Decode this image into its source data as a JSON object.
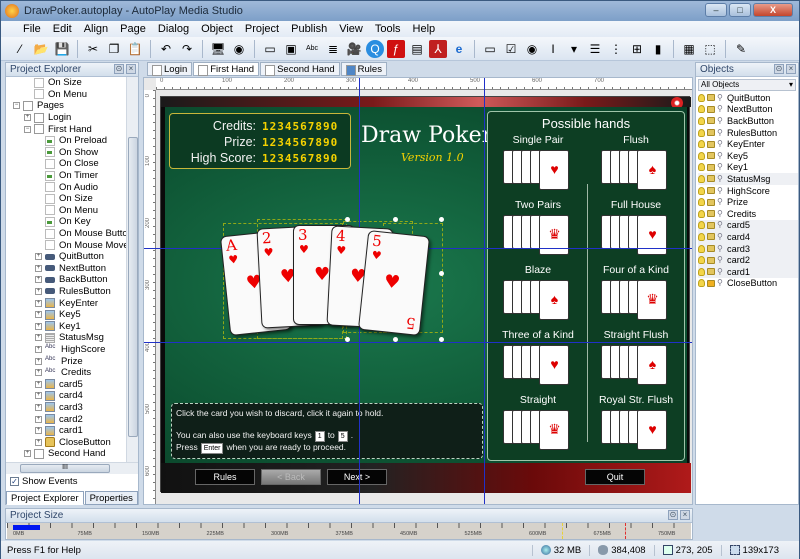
{
  "window": {
    "title": "DrawPoker.autoplay - AutoPlay Media Studio",
    "minimize": "–",
    "maximize": "□",
    "close": "X"
  },
  "menu": [
    "File",
    "Edit",
    "Align",
    "Page",
    "Dialog",
    "Object",
    "Project",
    "Publish",
    "View",
    "Tools",
    "Help"
  ],
  "toolbar_icons": [
    "magic-wand-icon",
    "open-folder-icon",
    "save-icon",
    "cut-icon",
    "copy-icon",
    "paste-icon",
    "undo-icon",
    "redo-icon",
    "preview-icon",
    "publish-icon",
    "button-object-icon",
    "image-object-icon",
    "label-object-icon",
    "paragraph-object-icon",
    "video-object-icon",
    "quicktime-object-icon",
    "flash-object-icon",
    "slideshow-object-icon",
    "pdf-object-icon",
    "web-object-icon",
    "input-object-icon",
    "checkbox-object-icon",
    "radio-object-icon",
    "textbox-object-icon",
    "combobox-object-icon",
    "listbox-object-icon",
    "tree-object-icon",
    "grid-object-icon",
    "progress-object-icon",
    "xbutton-object-icon",
    "hotspot-object-icon",
    "pencil-icon"
  ],
  "project_explorer": {
    "title": "Project Explorer",
    "items": [
      {
        "label": "On Size",
        "type": "evt",
        "indent": 2
      },
      {
        "label": "On Menu",
        "type": "evt",
        "indent": 2
      },
      {
        "label": "Pages",
        "type": "page",
        "indent": 1,
        "expander": "−"
      },
      {
        "label": "Login",
        "type": "page",
        "indent": 2,
        "expander": "+"
      },
      {
        "label": "First Hand",
        "type": "page",
        "indent": 2,
        "expander": "−"
      },
      {
        "label": "On Preload",
        "type": "evt act",
        "indent": 3
      },
      {
        "label": "On Show",
        "type": "evt act",
        "indent": 3
      },
      {
        "label": "On Close",
        "type": "evt",
        "indent": 3
      },
      {
        "label": "On Timer",
        "type": "evt act",
        "indent": 3
      },
      {
        "label": "On Audio",
        "type": "evt",
        "indent": 3
      },
      {
        "label": "On Size",
        "type": "evt",
        "indent": 3
      },
      {
        "label": "On Menu",
        "type": "evt",
        "indent": 3
      },
      {
        "label": "On Key",
        "type": "evt act",
        "indent": 3
      },
      {
        "label": "On Mouse Button",
        "type": "evt",
        "indent": 3
      },
      {
        "label": "On Mouse Move",
        "type": "evt",
        "indent": 3
      },
      {
        "label": "QuitButton",
        "type": "btn",
        "indent": 3,
        "expander": "+"
      },
      {
        "label": "NextButton",
        "type": "btn",
        "indent": 3,
        "expander": "+"
      },
      {
        "label": "BackButton",
        "type": "btn",
        "indent": 3,
        "expander": "+"
      },
      {
        "label": "RulesButton",
        "type": "btn",
        "indent": 3,
        "expander": "+"
      },
      {
        "label": "KeyEnter",
        "type": "img",
        "indent": 3,
        "expander": "+"
      },
      {
        "label": "Key5",
        "type": "img",
        "indent": 3,
        "expander": "+"
      },
      {
        "label": "Key1",
        "type": "img",
        "indent": 3,
        "expander": "+"
      },
      {
        "label": "StatusMsg",
        "type": "para",
        "indent": 3,
        "expander": "+"
      },
      {
        "label": "HighScore",
        "type": "abc",
        "indent": 3,
        "expander": "+"
      },
      {
        "label": "Prize",
        "type": "abc",
        "indent": 3,
        "expander": "+"
      },
      {
        "label": "Credits",
        "type": "abc",
        "indent": 3,
        "expander": "+"
      },
      {
        "label": "card5",
        "type": "img",
        "indent": 3,
        "expander": "+"
      },
      {
        "label": "card4",
        "type": "img",
        "indent": 3,
        "expander": "+"
      },
      {
        "label": "card3",
        "type": "img",
        "indent": 3,
        "expander": "+"
      },
      {
        "label": "card2",
        "type": "img",
        "indent": 3,
        "expander": "+"
      },
      {
        "label": "card1",
        "type": "img",
        "indent": 3,
        "expander": "+"
      },
      {
        "label": "CloseButton",
        "type": "lock",
        "indent": 3,
        "expander": "+"
      },
      {
        "label": "Second Hand",
        "type": "page",
        "indent": 2,
        "expander": "+"
      }
    ],
    "show_events_label": "Show Events",
    "show_events_checked": true,
    "tabs": [
      "Project Explorer",
      "Properties"
    ],
    "hscroll_grip": "III"
  },
  "doc_tabs": [
    {
      "label": "Login",
      "active": false
    },
    {
      "label": "First Hand",
      "active": true
    },
    {
      "label": "Second Hand",
      "active": false
    },
    {
      "label": "Rules",
      "active": false
    }
  ],
  "rulers": {
    "h": [
      "0",
      "100",
      "200",
      "300",
      "400",
      "500",
      "600",
      "700"
    ],
    "v": [
      "0",
      "100",
      "200",
      "300",
      "400",
      "500",
      "600"
    ]
  },
  "game": {
    "score": [
      {
        "label": "Credits:",
        "value": "1234567890"
      },
      {
        "label": "Prize:",
        "value": "1234567890"
      },
      {
        "label": "High Score:",
        "value": "1234567890"
      }
    ],
    "brand": "Draw Poker",
    "version": "Version 1.0",
    "hand_cards": [
      {
        "rank": "A",
        "suit": "♥"
      },
      {
        "rank": "2",
        "suit": "♥"
      },
      {
        "rank": "3",
        "suit": "♥"
      },
      {
        "rank": "4",
        "suit": "♥"
      },
      {
        "rank": "5",
        "suit": "♥"
      }
    ],
    "possible_hands_title": "Possible hands",
    "possible_hands": [
      {
        "name": "Single Pair",
        "col": 0
      },
      {
        "name": "Flush",
        "col": 1
      },
      {
        "name": "Two Pairs",
        "col": 0
      },
      {
        "name": "Full House",
        "col": 1
      },
      {
        "name": "Blaze",
        "col": 0
      },
      {
        "name": "Four of  a Kind",
        "col": 1
      },
      {
        "name": "Three of a Kind",
        "col": 0
      },
      {
        "name": "Straight Flush",
        "col": 1
      },
      {
        "name": "Straight",
        "col": 0
      },
      {
        "name": "Royal Str. Flush",
        "col": 1
      }
    ],
    "instructions": {
      "line1": "Click the card you wish to discard, click it again to hold.",
      "line2_a": "You can also use the keyboard keys",
      "key1": "1",
      "line2_to": "to",
      "key5": "5",
      "line2_end": ".",
      "line3_a": "Press",
      "key_enter": "Enter",
      "line3_b": "when you are ready to proceed."
    },
    "buttons": {
      "rules": "Rules",
      "back": "< Back",
      "next": "Next >",
      "quit": "Quit"
    }
  },
  "objects_panel": {
    "title": "Objects",
    "filter": "All Objects",
    "items": [
      "QuitButton",
      "NextButton",
      "BackButton",
      "RulesButton",
      "KeyEnter",
      "Key5",
      "Key1",
      "StatusMsg",
      "HighScore",
      "Prize",
      "Credits",
      "card5",
      "card4",
      "card3",
      "card2",
      "card1",
      "CloseButton"
    ],
    "highlighted": [
      "StatusMsg",
      "card5",
      "card4",
      "card3",
      "card2",
      "card1"
    ],
    "locked": [
      "CloseButton"
    ]
  },
  "project_size": {
    "title": "Project Size",
    "ticks": [
      "0MB",
      "75MB",
      "150MB",
      "225MB",
      "300MB",
      "375MB",
      "450MB",
      "525MB",
      "600MB",
      "675MB",
      "750MB"
    ],
    "used_fraction": 0.04
  },
  "statusbar": {
    "help": "Press F1 for Help",
    "memory": "32 MB",
    "size": "384,408",
    "position": "273, 205",
    "dimensions": "139x173"
  }
}
